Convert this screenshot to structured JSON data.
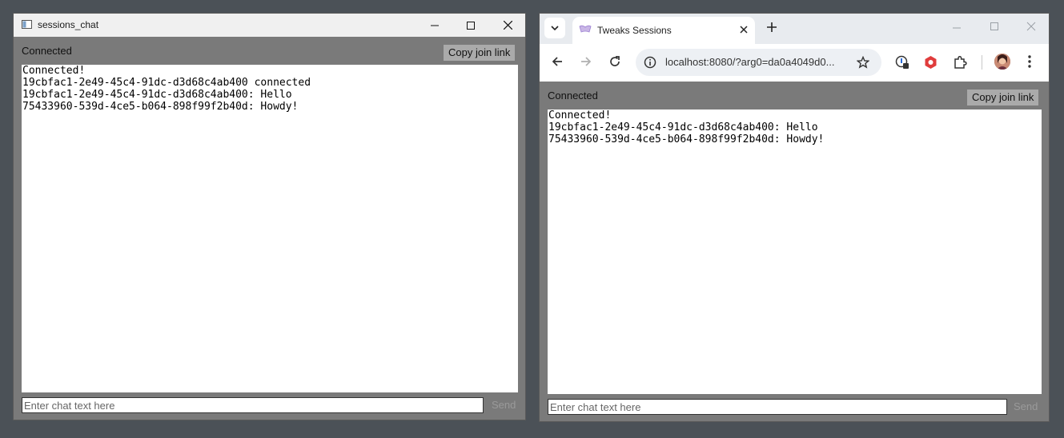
{
  "left_window": {
    "title": "sessions_chat",
    "status": "Connected",
    "copy_button": "Copy join link",
    "log": [
      "Connected!",
      "19cbfac1-2e49-45c4-91dc-d3d68c4ab400 connected",
      "19cbfac1-2e49-45c4-91dc-d3d68c4ab400: Hello",
      "75433960-539d-4ce5-b064-898f99f2b40d: Howdy!"
    ],
    "input_placeholder": "Enter chat text here",
    "send_button": "Send"
  },
  "browser": {
    "tab_title": "Tweaks Sessions",
    "url": "localhost:8080/?arg0=da0a4049d0...",
    "page": {
      "status": "Connected",
      "copy_button": "Copy join link",
      "log": [
        "Connected!",
        "19cbfac1-2e49-45c4-91dc-d3d68c4ab400: Hello",
        "75433960-539d-4ce5-b064-898f99f2b40d: Howdy!"
      ],
      "input_placeholder": "Enter chat text here",
      "send_button": "Send"
    }
  },
  "colors": {
    "desktop": "#4b5157",
    "app_background": "#7a7a7a",
    "button_background": "#aaaaaa",
    "titlebar": "#f0f0f0",
    "tabstrip": "#e8ebef"
  }
}
